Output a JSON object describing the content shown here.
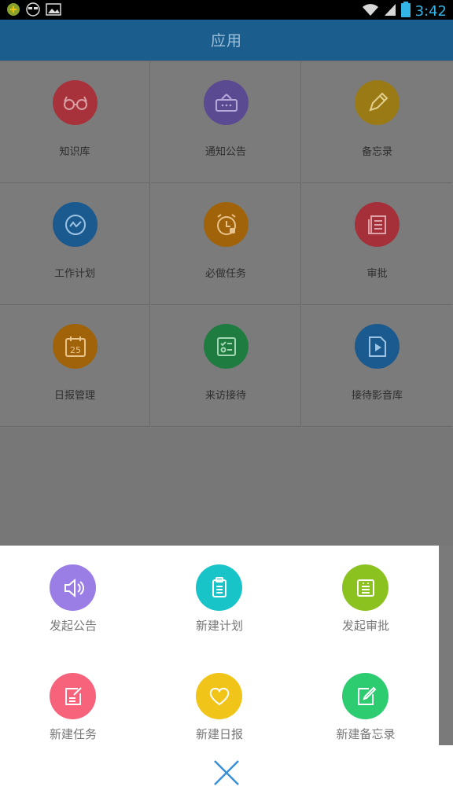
{
  "status_bar": {
    "time": "3:42"
  },
  "app_bar": {
    "title": "应用"
  },
  "grid": {
    "items": [
      {
        "label": "知识库",
        "color": "#a8323c",
        "icon": "glasses-icon"
      },
      {
        "label": "通知公告",
        "color": "#5a4a91",
        "icon": "notice-board-icon"
      },
      {
        "label": "备忘录",
        "color": "#9a7a14",
        "icon": "pencil-icon"
      },
      {
        "label": "工作计划",
        "color": "#1a5a8f",
        "icon": "trend-icon"
      },
      {
        "label": "必做任务",
        "color": "#a0630a",
        "icon": "alarm-clock-icon"
      },
      {
        "label": "审批",
        "color": "#a5303a",
        "icon": "document-list-icon"
      },
      {
        "label": "日报管理",
        "color": "#a0630a",
        "icon": "calendar-icon"
      },
      {
        "label": "来访接待",
        "color": "#1f7c40",
        "icon": "checklist-icon"
      },
      {
        "label": "接待影音库",
        "color": "#1a5a8f",
        "icon": "video-play-icon"
      }
    ]
  },
  "actions": {
    "items": [
      {
        "label": "发起公告",
        "color": "#9a7ee6",
        "icon": "speaker-icon"
      },
      {
        "label": "新建计划",
        "color": "#19c4c9",
        "icon": "clipboard-icon"
      },
      {
        "label": "发起审批",
        "color": "#8cc21f",
        "icon": "form-icon"
      },
      {
        "label": "新建任务",
        "color": "#f7637a",
        "icon": "edit-note-icon"
      },
      {
        "label": "新建日报",
        "color": "#f0c419",
        "icon": "heart-icon"
      },
      {
        "label": "新建备忘录",
        "color": "#2ecc71",
        "icon": "edit-square-icon"
      }
    ]
  },
  "close": {
    "icon": "close-icon",
    "color": "#3a8fd6"
  }
}
